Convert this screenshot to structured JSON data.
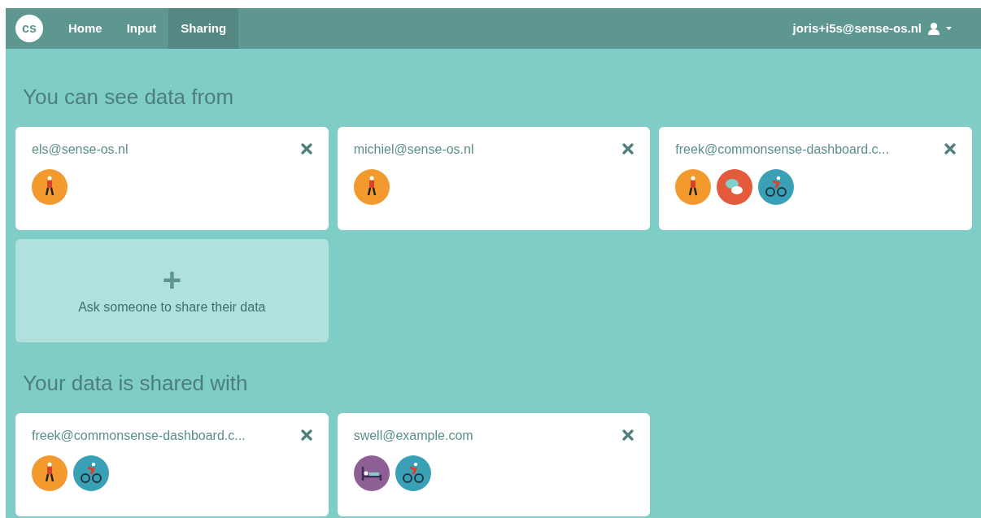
{
  "navbar": {
    "logo": "cs",
    "tabs": [
      {
        "label": "Home",
        "selected": false
      },
      {
        "label": "Input",
        "selected": false
      },
      {
        "label": "Sharing",
        "selected": true
      }
    ],
    "user": "joris+i5s@sense-os.nl"
  },
  "sections": [
    {
      "title": "You can see data from",
      "cards": [
        {
          "email": "els@sense-os.nl",
          "sensors": [
            {
              "kind": "walk",
              "color": "#f29a2e"
            }
          ]
        },
        {
          "email": "michiel@sense-os.nl",
          "sensors": [
            {
              "kind": "walk",
              "color": "#f29a2e"
            }
          ]
        },
        {
          "email": "freek@commonsense-dashboard.c...",
          "sensors": [
            {
              "kind": "walk",
              "color": "#f29a2e"
            },
            {
              "kind": "chat",
              "color": "#e55a3a"
            },
            {
              "kind": "bike",
              "color": "#3aa0b6"
            }
          ]
        }
      ],
      "add": {
        "symbol": "+",
        "label": "Ask someone to share their data"
      }
    },
    {
      "title": "Your data is shared with",
      "cards": [
        {
          "email": "freek@commonsense-dashboard.c...",
          "sensors": [
            {
              "kind": "walk",
              "color": "#f29a2e"
            },
            {
              "kind": "bike",
              "color": "#3aa0b6"
            }
          ]
        },
        {
          "email": "swell@example.com",
          "sensors": [
            {
              "kind": "sleep",
              "color": "#8e5f95"
            },
            {
              "kind": "bike",
              "color": "#3aa0b6"
            }
          ]
        }
      ]
    }
  ]
}
